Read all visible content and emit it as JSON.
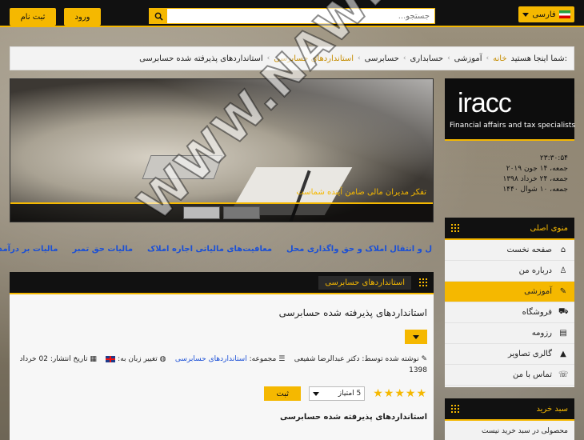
{
  "topbar": {
    "language": "فارسی",
    "search_placeholder": "جستجو...",
    "login_label": "ورود",
    "register_label": "ثبت نام"
  },
  "breadcrumb": {
    "prefix": "شما اینجا هستید:",
    "items": [
      "خانه",
      "آموزشی",
      "حسابداری",
      "حسابرسی",
      "استانداردهای حسابرسی",
      "استانداردهای پذیرفته شده حسابرسی"
    ]
  },
  "slider": {
    "caption": "تفکر مدیران مالی ضامن آینده شماست"
  },
  "marquee_links": [
    "ل و انتقال املاک و حق واگذاری محل",
    "معافیت‌های مالیاتی اجاره املاک",
    "مالیات حق تمبر",
    "مالیات بر درآمد اجاره اشخاص حقوق"
  ],
  "article": {
    "head_tag": "استانداردهای حسابرسی",
    "title": "استانداردهای پذیرفته شده حسابرسی",
    "author_label": "نوشته شده توسط:",
    "author": "دکتر عبدالرضا شفیعی",
    "category_label": "مجموعه:",
    "category": "استانداردهای حسابرسی",
    "lang_label": "تغییر زبان به:",
    "publish_label": "تاریخ انتشار:",
    "publish_date": "02 خرداد 1398",
    "stars": "★★★★★",
    "rating_select": "5 امتیاز",
    "submit_label": "ثبت",
    "body_title": "استانداردهای پذیرفته شده حسابرسی"
  },
  "brand": {
    "logo_text": "iracc",
    "subtitle": "Financial affairs and tax specialists"
  },
  "dates": {
    "time": "۲۳:۳۰:۵۴",
    "gregorian": "جمعه، ۱۴ جون ۲۰۱۹",
    "jalali": "جمعه، ۲۴ خرداد ۱۳۹۸",
    "hijri": "جمعه، ۱۰ شوال ۱۴۴۰"
  },
  "main_menu": {
    "title": "منوی اصلی",
    "items": [
      {
        "label": "صفحه نخست",
        "icon": "home-icon"
      },
      {
        "label": "درباره من",
        "icon": "user-icon"
      },
      {
        "label": "آموزشی",
        "icon": "edit-icon"
      },
      {
        "label": "فروشگاه",
        "icon": "cart-icon"
      },
      {
        "label": "رزومه",
        "icon": "file-icon"
      },
      {
        "label": "گالری تصاویر",
        "icon": "gallery-icon"
      },
      {
        "label": "تماس با من",
        "icon": "contact-icon"
      }
    ]
  },
  "cart": {
    "title": "سبد خرید",
    "empty_text": "محصولی در سبد خرید نیست"
  },
  "watermark": "WWW.NAWER.NET",
  "colors": {
    "accent": "#f5b800",
    "dark": "#111111",
    "link": "#1a4fd6"
  }
}
